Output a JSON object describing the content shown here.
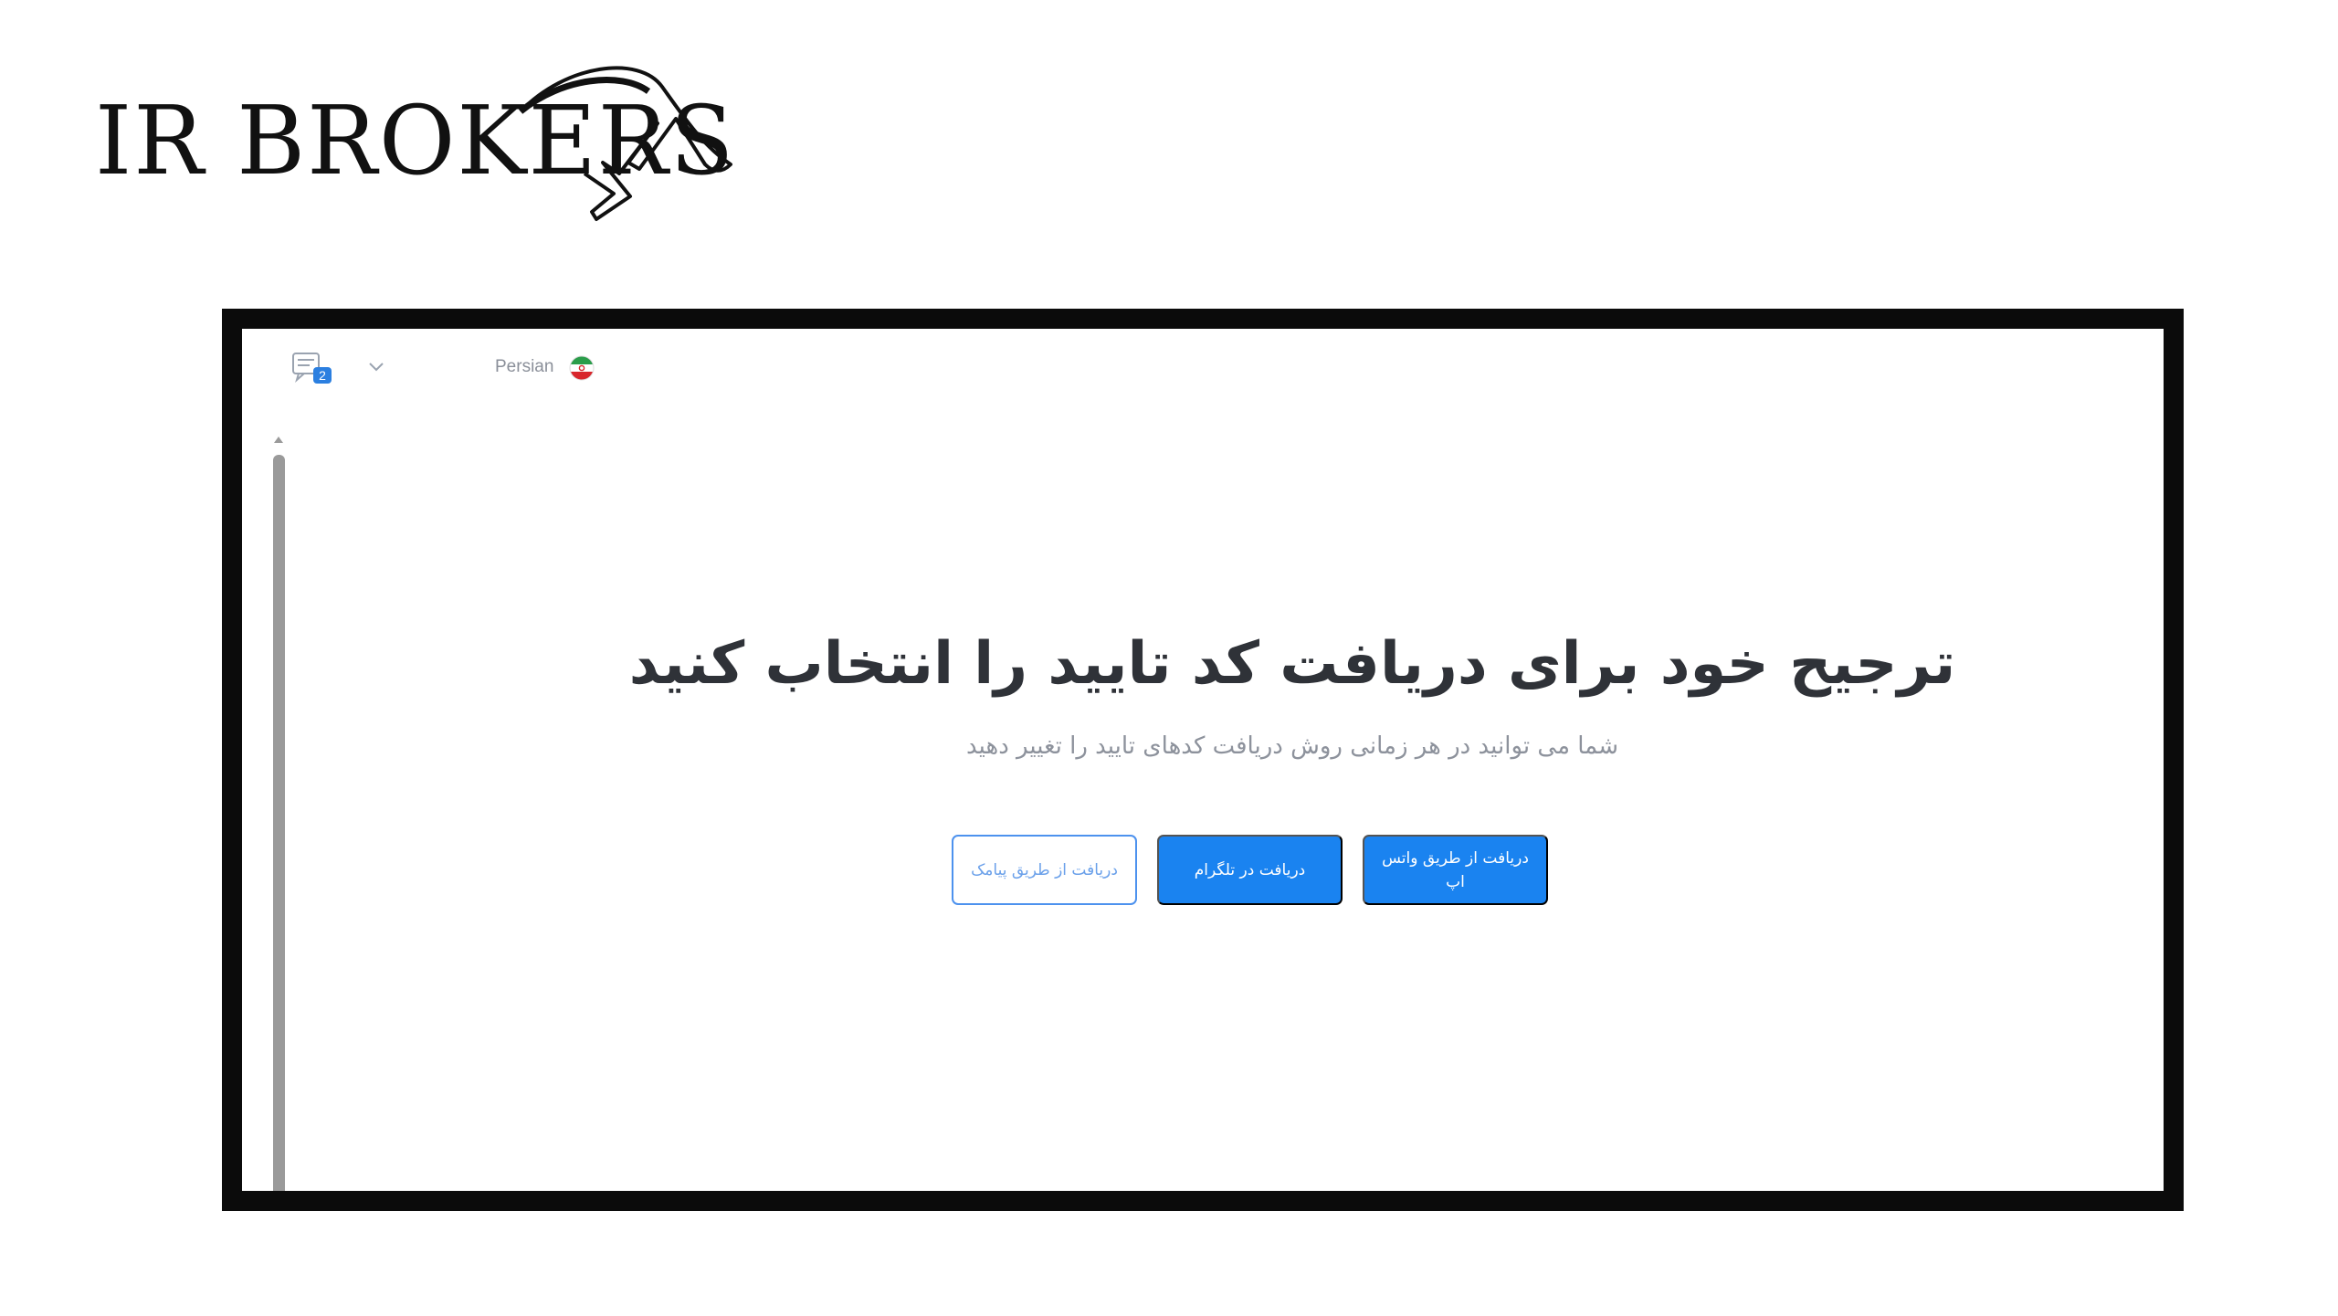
{
  "logo": {
    "text": "IR BROKERS"
  },
  "topbar": {
    "chat_badge": "2",
    "language_label": "Persian",
    "icons": [
      "chat-icon",
      "chevron-down-icon",
      "iran-flag-icon"
    ]
  },
  "main": {
    "title": "ترجیح خود برای دریافت کد تایید را انتخاب کنید",
    "subtitle": "شما می توانید در هر زمانی روش دریافت کدهای تایید را تغییر دهید",
    "buttons": {
      "sms": "دریافت از طریق پیامک",
      "telegram": "دریافت در تلگرام",
      "whatsapp": "دریافت از طریق واتس اپ"
    }
  },
  "colors": {
    "primary": "#1a83f0",
    "frame": "#0b0b0b",
    "heading": "#2f3238",
    "muted": "#8d929c"
  }
}
